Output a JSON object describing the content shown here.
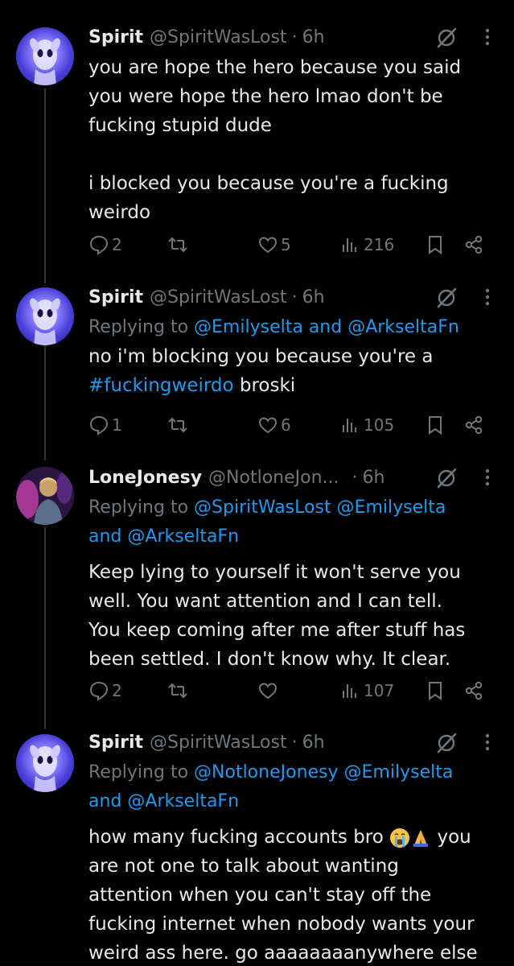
{
  "colors": {
    "background": "#000000",
    "text": "#e7e9ea",
    "muted": "#71767b",
    "link": "#1d9bf0"
  },
  "tweets": [
    {
      "name": "Spirit",
      "handle": "@SpiritWasLost",
      "time": "6h",
      "replying_prefix": "",
      "lines": [
        "you are hope the hero because you said",
        "you were hope the hero lmao don't be",
        "fucking stupid dude",
        "",
        "i blocked you because you're a fucking",
        "weirdo"
      ],
      "replies": "2",
      "reposts": "",
      "likes": "5",
      "views": "216"
    },
    {
      "name": "Spirit",
      "handle": "@SpiritWasLost",
      "time": "6h",
      "replying_prefix": "Replying to",
      "replying_mentions": "@Emilyselta and @ArkseltaFn",
      "line1": "no i'm blocking you because you're a",
      "hashtag": "#fuckingweirdo",
      "line2_rest": " broski",
      "replies": "1",
      "reposts": "",
      "likes": "6",
      "views": "105"
    },
    {
      "name": "LoneJonesy",
      "handle": "@NotloneJon...",
      "time": "6h",
      "replying_prefix": "Replying to",
      "replying_mentions_1": "@SpiritWasLost @Emilyselta",
      "replying_mentions_2": "and @ArkseltaFn",
      "lines": [
        "Keep lying to yourself it won't serve you",
        "well. You want attention and I can tell.",
        "You keep coming after me after stuff has",
        "been settled. I don't know why. It clear."
      ],
      "replies": "2",
      "reposts": "",
      "likes": "",
      "views": "107"
    },
    {
      "name": "Spirit",
      "handle": "@SpiritWasLost",
      "time": "6h",
      "replying_prefix": "Replying to",
      "replying_mentions_1": "@NotloneJonesy @Emilyselta",
      "replying_mentions_2": "and @ArkseltaFn",
      "line1_start": "how many fucking accounts bro ",
      "line1_end": " you",
      "lines_rest": [
        "are not one to talk about wanting",
        "attention when you can't stay off the",
        "fucking internet when nobody wants your",
        "weird ass here. go aaaaaaaanywhere else"
      ]
    }
  ]
}
